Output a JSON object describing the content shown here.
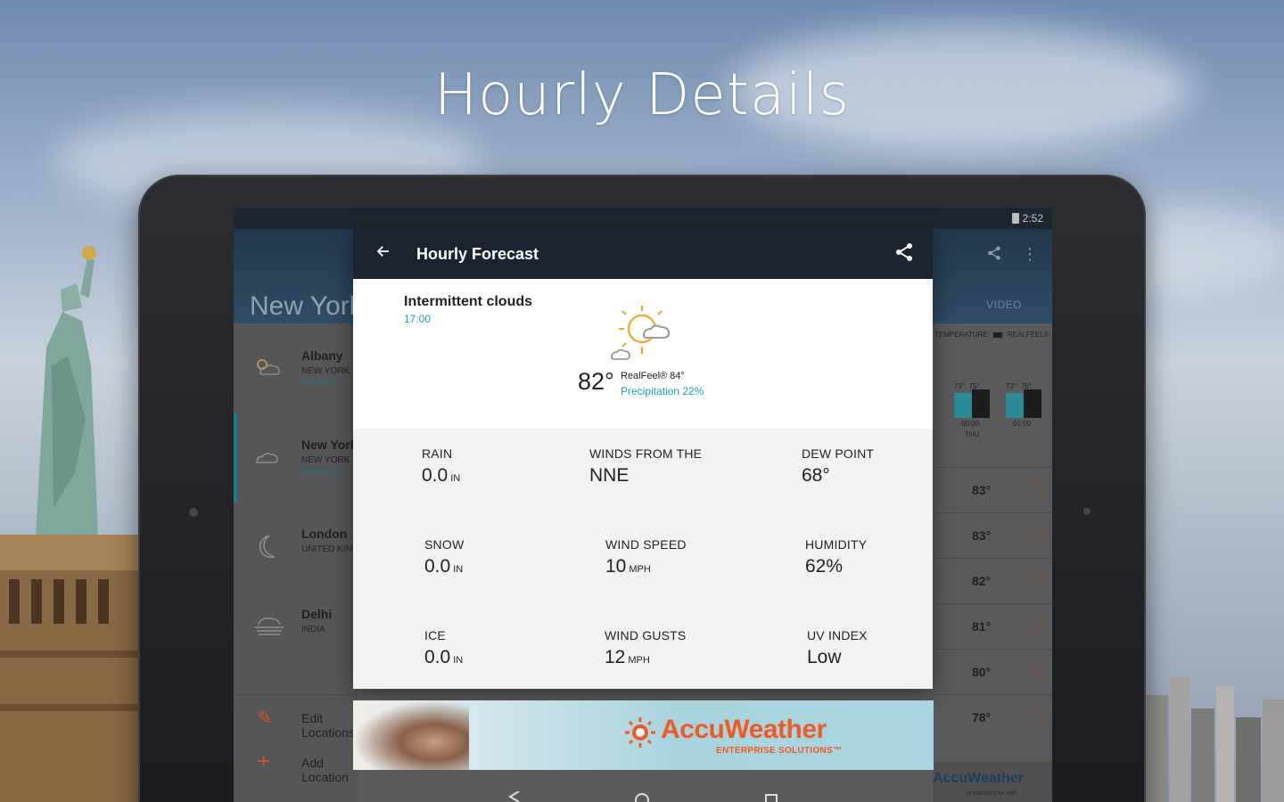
{
  "hero": {
    "title": "Hourly Details"
  },
  "status": {
    "time": "2:52"
  },
  "background_app": {
    "city": "New York",
    "video_tab": "VIDEO",
    "legend": {
      "temperature": "TEMPERATURE",
      "realfeel": "REALFEEL®"
    },
    "locations": [
      {
        "name": "Albany",
        "region": "NEW YORK",
        "tag": "CURRENT",
        "icon": "partly-sunny-icon"
      },
      {
        "name": "New York",
        "region": "NEW YORK",
        "tag": "FAVORITE",
        "icon": "cloud-icon"
      },
      {
        "name": "London",
        "region": "UNITED KINGDOM",
        "tag": "",
        "icon": "moon-icon"
      },
      {
        "name": "Delhi",
        "region": "INDIA",
        "tag": "",
        "icon": "fog-icon"
      }
    ],
    "actions": [
      {
        "label": "Edit Locations",
        "icon": "pencil-icon"
      },
      {
        "label": "Add Location",
        "icon": "plus-icon"
      }
    ],
    "bars": [
      {
        "temp": "73°",
        "realfeel": "75°",
        "time": "00:00",
        "day": "THU"
      },
      {
        "temp": "72°",
        "realfeel": "75°",
        "time": "01:00",
        "day": ""
      }
    ],
    "hourly_temps": [
      "83°",
      "83°",
      "82°",
      "81°",
      "80°",
      "78°"
    ],
    "footer_brand": "AccuWeather",
    "footer_partner": "in partnership with"
  },
  "dialog": {
    "title": "Hourly Forecast",
    "condition": "Intermittent clouds",
    "time": "17:00",
    "temperature": "82°",
    "realfeel": "RealFeel® 84°",
    "precipitation": "Precipitation 22%",
    "details": [
      {
        "label": "RAIN",
        "value": "0.0",
        "unit": "IN"
      },
      {
        "label": "WINDS FROM THE",
        "value": "NNE",
        "unit": ""
      },
      {
        "label": "DEW POINT",
        "value": "68°",
        "unit": ""
      },
      {
        "label": "SNOW",
        "value": "0.0",
        "unit": "IN"
      },
      {
        "label": "WIND SPEED",
        "value": "10",
        "unit": "MPH"
      },
      {
        "label": "HUMIDITY",
        "value": "62%",
        "unit": ""
      },
      {
        "label": "ICE",
        "value": "0.0",
        "unit": "IN"
      },
      {
        "label": "WIND GUSTS",
        "value": "12",
        "unit": "MPH"
      },
      {
        "label": "UV INDEX",
        "value": "Low",
        "unit": ""
      }
    ]
  },
  "ad": {
    "brand": "AccuWeather",
    "subtitle": "ENTERPRISE SOLUTIONS™"
  },
  "colors": {
    "accent": "#1aa2b2",
    "brand": "#ef5a24",
    "toolbar": "#1b2430"
  }
}
